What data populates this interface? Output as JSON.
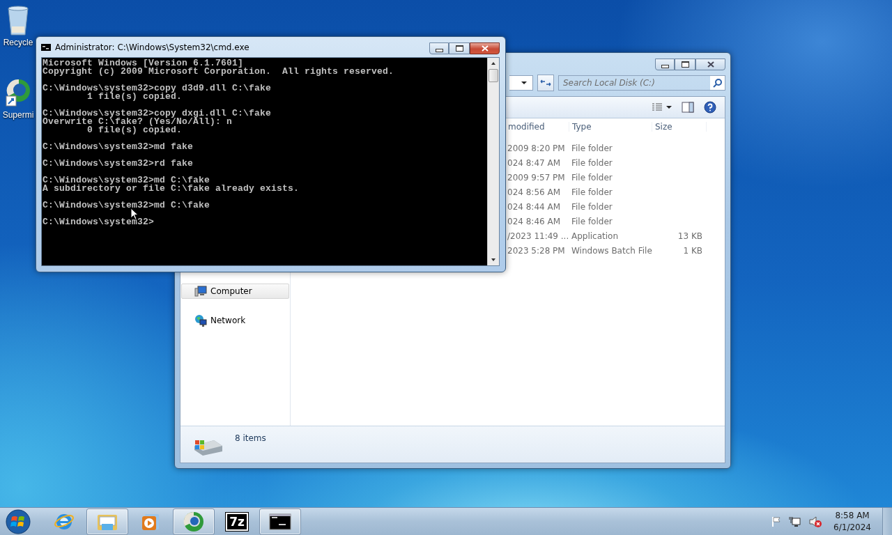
{
  "desktop_icons": [
    {
      "kind": "recycle-bin",
      "label": "Recycle"
    },
    {
      "kind": "app-shortcut",
      "label": "Supermi"
    }
  ],
  "explorer": {
    "search": {
      "placeholder": "Search Local Disk (C:)"
    },
    "columns": [
      "modified",
      "Type",
      "Size"
    ],
    "rows": [
      {
        "modified": "2009 8:20 PM",
        "type": "File folder"
      },
      {
        "modified": "024 8:47 AM",
        "type": "File folder"
      },
      {
        "modified": "2009 9:57 PM",
        "type": "File folder"
      },
      {
        "modified": "024 8:56 AM",
        "type": "File folder"
      },
      {
        "modified": "024 8:44 AM",
        "type": "File folder"
      },
      {
        "modified": "024 8:46 AM",
        "type": "File folder"
      },
      {
        "modified": "/2023 11:49 ...",
        "type": "Application",
        "size": "13 KB"
      },
      {
        "modified": "2023 5:28 PM",
        "type": "Windows Batch File",
        "size": "1 KB"
      }
    ],
    "nav_items": [
      {
        "kind": "computer",
        "label": "Computer",
        "selected": true
      },
      {
        "kind": "network",
        "label": "Network",
        "selected": false
      }
    ],
    "status": "8 items"
  },
  "cmd": {
    "title": "Administrator: C:\\Windows\\System32\\cmd.exe",
    "blocks": [
      [
        "Microsoft Windows [Version 6.1.7601]",
        "Copyright (c) 2009 Microsoft Corporation.  All rights reserved."
      ],
      [
        "C:\\Windows\\system32>copy d3d9.dll C:\\fake",
        "        1 file(s) copied."
      ],
      [
        "C:\\Windows\\system32>copy dxgi.dll C:\\fake",
        "Overwrite C:\\fake? (Yes/No/All): n",
        "        0 file(s) copied."
      ],
      [
        "C:\\Windows\\system32>md fake"
      ],
      [
        "C:\\Windows\\system32>rd fake"
      ],
      [
        "C:\\Windows\\system32>md C:\\fake",
        "A subdirectory or file C:\\fake already exists."
      ],
      [
        "C:\\Windows\\system32>md C:\\fake"
      ],
      [
        "C:\\Windows\\system32>"
      ]
    ]
  },
  "taskbar": {
    "items": [
      {
        "kind": "ie",
        "running": false
      },
      {
        "kind": "explorer",
        "running": true
      },
      {
        "kind": "media-player",
        "running": false
      },
      {
        "kind": "browser",
        "running": true
      },
      {
        "kind": "archiver",
        "label": "7z",
        "running": false
      },
      {
        "kind": "console",
        "running": true
      }
    ],
    "clock": {
      "time": "8:58 AM",
      "date": "6/1/2024"
    }
  }
}
